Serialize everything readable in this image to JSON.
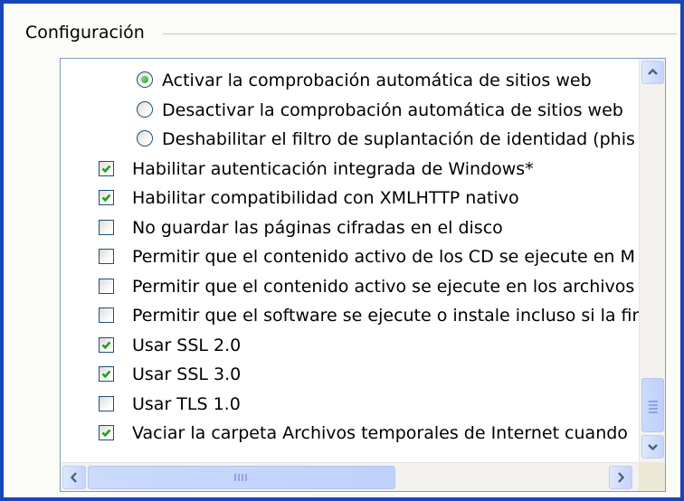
{
  "group": {
    "title": "Configuración"
  },
  "items": [
    {
      "type": "radio",
      "checked": true,
      "label": "Activar la comprobación automática de sitios web"
    },
    {
      "type": "radio",
      "checked": false,
      "label": "Desactivar la comprobación automática de sitios web"
    },
    {
      "type": "radio",
      "checked": false,
      "label": "Deshabilitar el filtro de suplantación de identidad (phis"
    },
    {
      "type": "checkbox",
      "checked": true,
      "label": "Habilitar autenticación integrada de Windows*"
    },
    {
      "type": "checkbox",
      "checked": true,
      "label": "Habilitar compatibilidad con XMLHTTP nativo"
    },
    {
      "type": "checkbox",
      "checked": false,
      "label": "No guardar las páginas cifradas en el disco"
    },
    {
      "type": "checkbox",
      "checked": false,
      "label": "Permitir que el contenido activo de los CD se ejecute en M"
    },
    {
      "type": "checkbox",
      "checked": false,
      "label": "Permitir que el contenido activo se ejecute en los archivos"
    },
    {
      "type": "checkbox",
      "checked": false,
      "label": "Permitir que el software se ejecute o instale incluso si la fir"
    },
    {
      "type": "checkbox",
      "checked": true,
      "label": "Usar SSL 2.0"
    },
    {
      "type": "checkbox",
      "checked": true,
      "label": "Usar SSL 3.0"
    },
    {
      "type": "checkbox",
      "checked": false,
      "label": "Usar TLS 1.0"
    },
    {
      "type": "checkbox",
      "checked": true,
      "label": "Vaciar la carpeta Archivos temporales de Internet cuando"
    }
  ],
  "scrollbars": {
    "vertical": {
      "position_fraction": 0.86,
      "up_icon": "chevron-up-icon",
      "down_icon": "chevron-down-icon"
    },
    "horizontal": {
      "position_fraction": 0.0,
      "left_icon": "chevron-left-icon",
      "right_icon": "chevron-right-icon"
    }
  },
  "colors": {
    "frame_border": "#1a44b8",
    "check_mark": "#21a121",
    "control_border": "#1c5180"
  }
}
